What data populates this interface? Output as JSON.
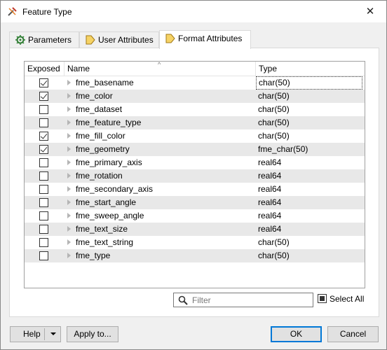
{
  "window": {
    "title": "Feature Type",
    "close_glyph": "✕"
  },
  "tabs": [
    {
      "label": "Parameters",
      "icon": "gear-icon"
    },
    {
      "label": "User Attributes",
      "icon": "tag-icon"
    },
    {
      "label": "Format Attributes",
      "icon": "tag-icon",
      "active": true
    }
  ],
  "grid": {
    "columns": {
      "exposed": "Exposed",
      "name": "Name",
      "type": "Type"
    },
    "rows": [
      {
        "exposed": true,
        "name": "fme_basename",
        "type": "char(50)"
      },
      {
        "exposed": true,
        "name": "fme_color",
        "type": "char(50)"
      },
      {
        "exposed": false,
        "name": "fme_dataset",
        "type": "char(50)"
      },
      {
        "exposed": false,
        "name": "fme_feature_type",
        "type": "char(50)"
      },
      {
        "exposed": true,
        "name": "fme_fill_color",
        "type": "char(50)"
      },
      {
        "exposed": true,
        "name": "fme_geometry",
        "type": "fme_char(50)"
      },
      {
        "exposed": false,
        "name": "fme_primary_axis",
        "type": "real64"
      },
      {
        "exposed": false,
        "name": "fme_rotation",
        "type": "real64"
      },
      {
        "exposed": false,
        "name": "fme_secondary_axis",
        "type": "real64"
      },
      {
        "exposed": false,
        "name": "fme_start_angle",
        "type": "real64"
      },
      {
        "exposed": false,
        "name": "fme_sweep_angle",
        "type": "real64"
      },
      {
        "exposed": false,
        "name": "fme_text_size",
        "type": "real64"
      },
      {
        "exposed": false,
        "name": "fme_text_string",
        "type": "char(50)"
      },
      {
        "exposed": false,
        "name": "fme_type",
        "type": "char(50)"
      }
    ]
  },
  "filter": {
    "placeholder": "Filter",
    "value": ""
  },
  "select_all": {
    "label": "Select All",
    "state": "partial"
  },
  "buttons": {
    "help": "Help",
    "apply_to": "Apply to...",
    "ok": "OK",
    "cancel": "Cancel"
  },
  "colors": {
    "alt_row": "#e8e8e8",
    "accent": "#0078d7"
  }
}
